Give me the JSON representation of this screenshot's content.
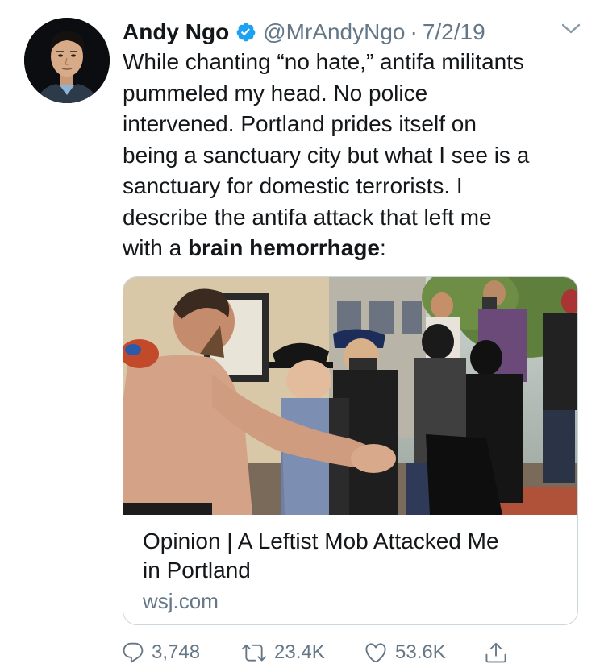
{
  "author": {
    "name": "Andy Ngo",
    "handle": "@MrAndyNgo",
    "separator": "·",
    "date": "7/2/19"
  },
  "tweet": {
    "lines": [
      "While chanting “no hate,” antifa militants",
      "pummeled my head. No police",
      "intervened. Portland prides itself on",
      "being a sanctuary city but what I see is a",
      "sanctuary for domestic terrorists. I",
      "describe the antifa attack that left me"
    ],
    "last_line_prefix": "with a ",
    "last_line_bold": "brain hemorrhage",
    "last_line_suffix": ":"
  },
  "card": {
    "title_line1": "Opinion | A Leftist Mob Attacked Me",
    "title_line2": "in Portland",
    "domain": "wsj.com"
  },
  "actions": {
    "replies": "3,748",
    "retweets": "23.4K",
    "likes": "53.6K"
  },
  "colors": {
    "text": "#14171a",
    "secondary": "#657786",
    "verified": "#1da1f2",
    "border": "#ccd6dd"
  }
}
